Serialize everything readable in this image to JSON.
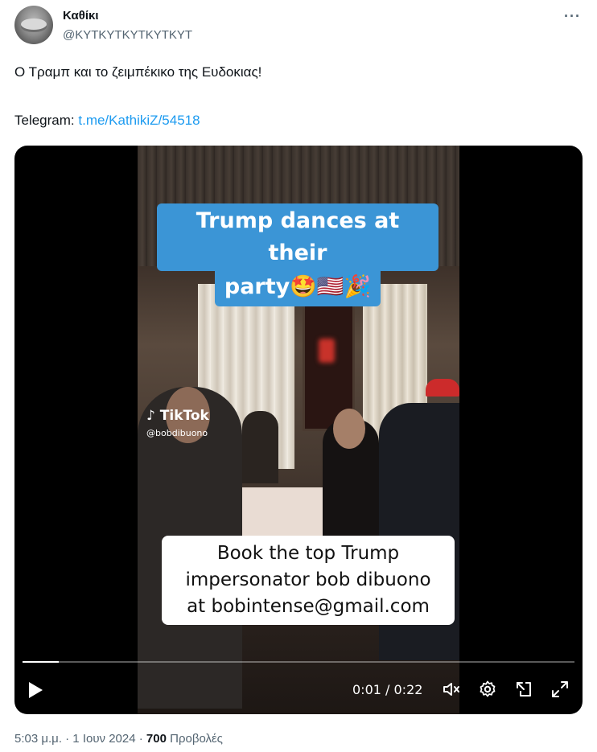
{
  "author": {
    "name": "Καθίκι",
    "handle": "@KYTKYTKYTKYTKYT"
  },
  "tweet": {
    "text": "Ο Τραμπ και το ζειμπέκικο της Ευδοκιας!",
    "telegram_label": "Telegram: ",
    "telegram_link": "t.me/KathikiZ/54518"
  },
  "video": {
    "banner_line1": "Trump dances at their",
    "banner_line2": "party🤩🇺🇸🎉",
    "watermark_brand": "TikTok",
    "watermark_user": "@bobdibuono",
    "caption_line1": "Book the top Trump",
    "caption_line2": "impersonator bob dibuono",
    "caption_line3": "at bobintense@gmail.com",
    "time_display": "0:01 / 0:22",
    "progress_fraction": 0.065
  },
  "footer": {
    "timestamp": "5:03 μ.μ. · 1 Ιουν 2024 · ",
    "views_count": "700",
    "views_label": " Προβολές"
  },
  "icons": {
    "more": "more-options-icon",
    "play": "play-icon",
    "mute": "mute-icon",
    "settings": "settings-icon",
    "pip": "picture-in-picture-icon",
    "fullscreen": "fullscreen-icon"
  }
}
